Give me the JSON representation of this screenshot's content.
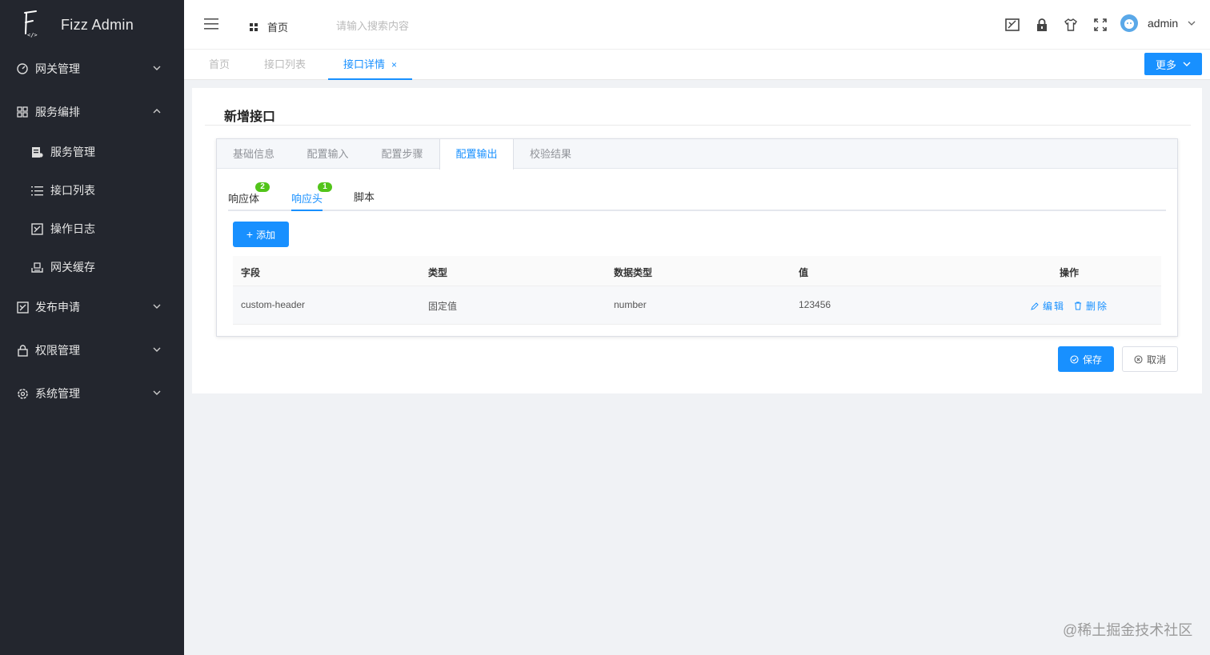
{
  "app": {
    "title": "Fizz Admin"
  },
  "sidebar": {
    "items": [
      {
        "label": "网关管理",
        "icon": "dashboard-icon",
        "expanded": false
      },
      {
        "label": "服务编排",
        "icon": "apps-grid-icon",
        "expanded": true,
        "children": [
          {
            "label": "服务管理",
            "icon": "service-doc-icon"
          },
          {
            "label": "接口列表",
            "icon": "list-icon"
          },
          {
            "label": "操作日志",
            "icon": "log-icon"
          },
          {
            "label": "网关缓存",
            "icon": "cache-icon"
          }
        ]
      },
      {
        "label": "发布申请",
        "icon": "publish-icon",
        "expanded": false
      },
      {
        "label": "权限管理",
        "icon": "lock-icon",
        "expanded": false
      },
      {
        "label": "系统管理",
        "icon": "gear-icon",
        "expanded": false
      }
    ]
  },
  "header": {
    "home_label": "首页",
    "search_placeholder": "请输入搜索内容",
    "username": "admin"
  },
  "tags": {
    "items": [
      {
        "label": "首页",
        "active": false
      },
      {
        "label": "接口列表",
        "active": false
      },
      {
        "label": "接口详情",
        "active": true,
        "closable": true
      }
    ],
    "close_glyph": "×",
    "more_label": "更多"
  },
  "page": {
    "title": "新增接口",
    "tabs": [
      {
        "label": "基础信息"
      },
      {
        "label": "配置输入"
      },
      {
        "label": "配置步骤"
      },
      {
        "label": "配置输出",
        "active": true
      },
      {
        "label": "校验结果"
      }
    ],
    "subtabs": [
      {
        "label": "响应体",
        "badge": "2"
      },
      {
        "label": "响应头",
        "badge": "1",
        "active": true
      },
      {
        "label": "脚本"
      }
    ],
    "add_label": "添加",
    "table": {
      "columns": [
        "字段",
        "类型",
        "数据类型",
        "值",
        "操作"
      ],
      "rows": [
        {
          "field": "custom-header",
          "type": "固定值",
          "data_type": "number",
          "value": "123456"
        }
      ],
      "edit_label": "编辑",
      "delete_label": "删除"
    },
    "save_label": "保存",
    "cancel_label": "取消"
  },
  "watermark": "@稀土掘金技术社区",
  "colors": {
    "sidebar_bg": "#23262e",
    "primary": "#1890ff",
    "badge_green": "#52c41a"
  }
}
